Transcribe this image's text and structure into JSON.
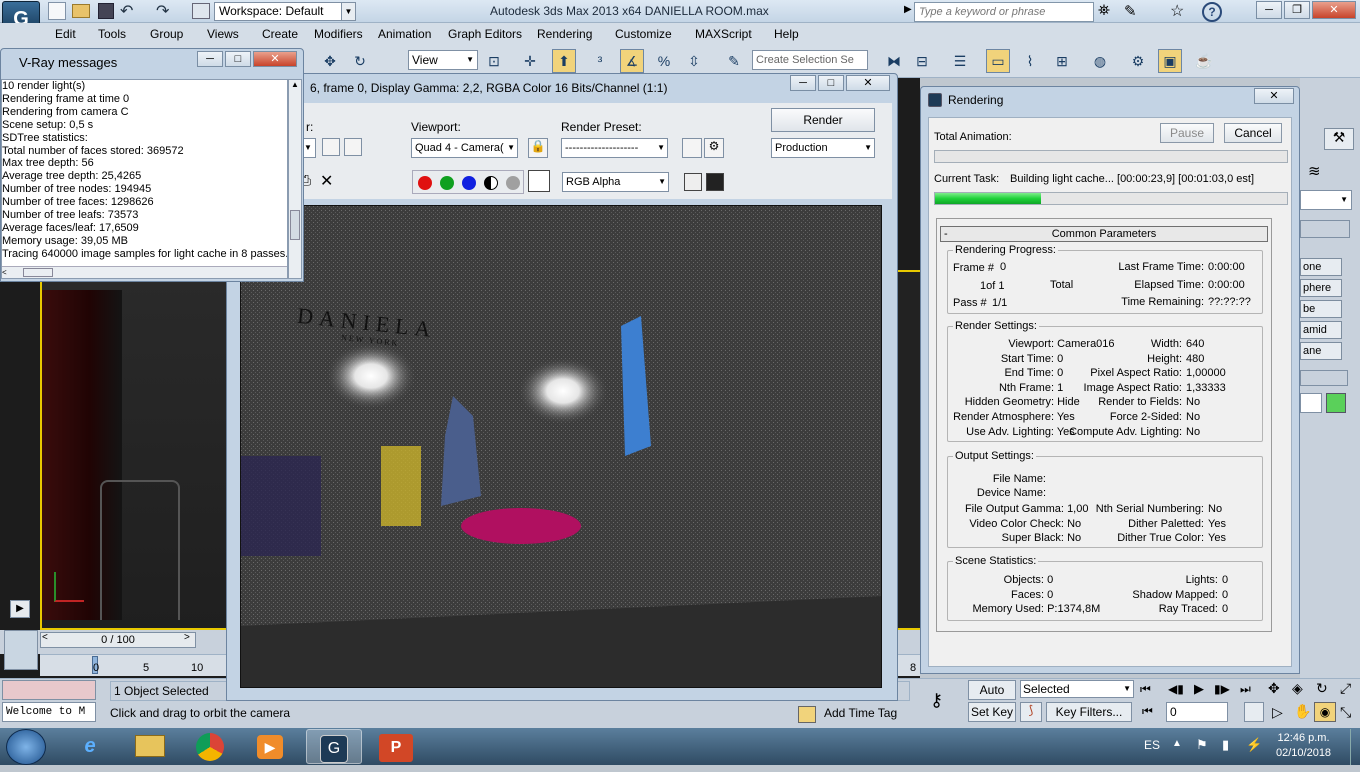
{
  "titlebar": {
    "workspace": "Workspace: Default",
    "title": "Autodesk 3ds Max  2013 x64     DANIELLA ROOM.max",
    "search_placeholder": "Type a keyword or phrase"
  },
  "menu": [
    "Edit",
    "Tools",
    "Group",
    "Views",
    "Create",
    "Modifiers",
    "Animation",
    "Graph Editors",
    "Rendering",
    "Customize",
    "MAXScript",
    "Help"
  ],
  "toolbar": {
    "view": "View",
    "selection_set": "Create Selection Se"
  },
  "vray": {
    "title": "V-Ray messages",
    "lines": [
      "10 render light(s)",
      "Rendering frame at time 0",
      "Rendering from camera C",
      "Scene setup: 0,5 s",
      "SDTree statistics:",
      "Total number of faces stored: 369572",
      "Max tree depth: 56",
      "Average tree depth: 25,4265",
      "Number of tree nodes: 194945",
      "Number of tree faces: 1298626",
      "Number of tree leafs: 73573",
      "Average faces/leaf: 17,6509",
      "Memory usage: 39,05 MB",
      "Tracing 640000 image samples for light cache in 8 passes."
    ]
  },
  "vfb": {
    "title": "6, frame 0, Display Gamma: 2,2, RGBA Color 16 Bits/Channel (1:1)",
    "viewport_label": "Viewport:",
    "viewport_value": "Quad 4 - Camera(",
    "preset_label": "Render Preset:",
    "preset_value": "--------------------",
    "render_label": "Render",
    "mode_value": "Production",
    "channel_value": "RGB Alpha",
    "area_label": "r:"
  },
  "scene": {
    "logo": "DANIELA",
    "logo_sub": "NEW YORK"
  },
  "rendering": {
    "title": "Rendering",
    "total_animation": "Total Animation:",
    "pause": "Pause",
    "cancel": "Cancel",
    "current_task_label": "Current Task:",
    "current_task": "Building light cache... [00:00:23,9] [00:01:03,0 est]",
    "task_progress": 0.3,
    "common_params": "Common Parameters",
    "progress": {
      "label": "Rendering Progress:",
      "frame_label": "Frame #",
      "frame": "0",
      "of": "1of 1",
      "total": "Total",
      "pass_label": "Pass #",
      "pass": "1/1",
      "last_frame_label": "Last Frame Time:",
      "last_frame": "0:00:00",
      "elapsed_label": "Elapsed Time:",
      "elapsed": "0:00:00",
      "remaining_label": "Time Remaining:",
      "remaining": "??:??:??"
    },
    "settings": {
      "label": "Render Settings:",
      "left": [
        [
          "Viewport:",
          "Camera016"
        ],
        [
          "Start Time:",
          "0"
        ],
        [
          "End Time:",
          "0"
        ],
        [
          "Nth Frame:",
          "1"
        ],
        [
          "Hidden Geometry:",
          "Hide"
        ],
        [
          "Render Atmosphere:",
          "Yes"
        ],
        [
          "Use Adv. Lighting:",
          "Yes"
        ]
      ],
      "right": [
        [
          "Width:",
          "640"
        ],
        [
          "Height:",
          "480"
        ],
        [
          "Pixel Aspect Ratio:",
          "1,00000"
        ],
        [
          "Image Aspect Ratio:",
          "1,33333"
        ],
        [
          "Render to Fields:",
          "No"
        ],
        [
          "Force 2-Sided:",
          "No"
        ],
        [
          "Compute Adv. Lighting:",
          "No"
        ]
      ]
    },
    "output": {
      "label": "Output Settings:",
      "file_name": "File Name:",
      "device_name": "Device Name:",
      "left": [
        [
          "File Output Gamma:",
          "1,00"
        ],
        [
          "Video Color Check:",
          "No"
        ],
        [
          "Super Black:",
          "No"
        ]
      ],
      "right": [
        [
          "Nth Serial Numbering:",
          "No"
        ],
        [
          "Dither Paletted:",
          "Yes"
        ],
        [
          "Dither True Color:",
          "Yes"
        ]
      ]
    },
    "stats": {
      "label": "Scene Statistics:",
      "left": [
        [
          "Objects:",
          "0"
        ],
        [
          "Faces:",
          "0"
        ],
        [
          "Memory Used:",
          "P:1374,8M"
        ]
      ],
      "right": [
        [
          "Lights:",
          "0"
        ],
        [
          "Shadow Mapped:",
          "0"
        ],
        [
          "Ray Traced:",
          "0"
        ]
      ]
    }
  },
  "cmdpanel": {
    "items": [
      "one",
      "phere",
      "be",
      "amid",
      "ane"
    ]
  },
  "timeline": {
    "slider": "0 / 100",
    "ticks": [
      "0",
      "5",
      "10"
    ],
    "end_tick": "8"
  },
  "status": {
    "maxscript": "Welcome to M",
    "selected": "1 Object Selected",
    "prompt": "Click and drag to orbit the camera",
    "add_time_tag": "Add Time Tag",
    "auto_key": "Auto Key",
    "set_key": "Set Key",
    "selected_dd": "Selected",
    "key_filters": "Key Filters...",
    "frame": "0"
  },
  "taskbar": {
    "lang": "ES",
    "time": "12:46 p.m.",
    "date": "02/10/2018"
  },
  "colors": {
    "progress_green": "#1fd23a",
    "viewport_border": "#e8c900"
  }
}
